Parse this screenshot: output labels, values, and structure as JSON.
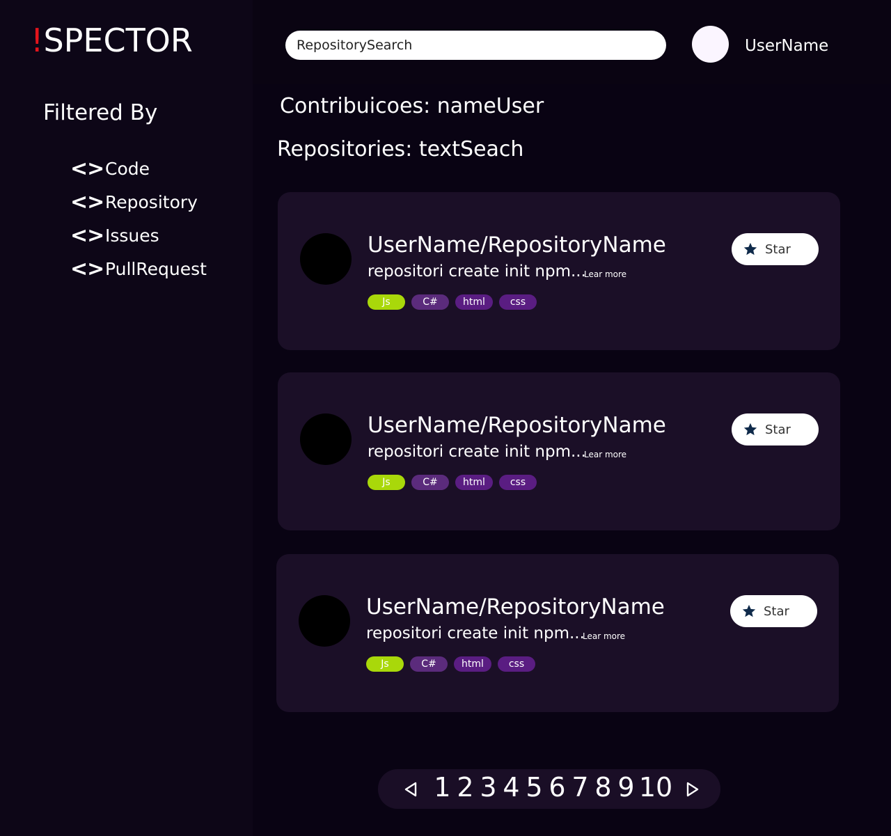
{
  "logo": {
    "bang": "!",
    "text": "SPECTOR"
  },
  "header": {
    "search_value": "RepositorySearch",
    "username": "UserName"
  },
  "sidebar": {
    "title": "Filtered By",
    "items": [
      {
        "icon": "<>",
        "label": "Code"
      },
      {
        "icon": "<>",
        "label": "Repository"
      },
      {
        "icon": "<>",
        "label": "Issues"
      },
      {
        "icon": "<>",
        "label": "PullRequest"
      }
    ]
  },
  "main": {
    "contrib": "Contribuicoes: nameUser",
    "repos_title": "Repositories: textSeach",
    "repos": [
      {
        "name": "UserName/RepositoryName",
        "desc": "repositori create init npm...",
        "learn": "Lear more",
        "star": "Star",
        "tags": [
          "Js",
          "C#",
          "html",
          "css"
        ]
      },
      {
        "name": "UserName/RepositoryName",
        "desc": "repositori create init npm...",
        "learn": "Lear more",
        "star": "Star",
        "tags": [
          "Js",
          "C#",
          "html",
          "css"
        ]
      },
      {
        "name": "UserName/RepositoryName",
        "desc": "repositori create init npm...",
        "learn": "Lear more",
        "star": "Star",
        "tags": [
          "Js",
          "C#",
          "html",
          "css"
        ]
      }
    ]
  },
  "pagination": {
    "pages": [
      "1",
      "2",
      "3",
      "4",
      "5",
      "6",
      "7",
      "8",
      "9",
      "10"
    ]
  },
  "colors": {
    "accent": "#e3141c",
    "js_tag": "#a9d80a",
    "purple_tag": "#5a1d82",
    "star_icon": "#0f2a4a"
  }
}
